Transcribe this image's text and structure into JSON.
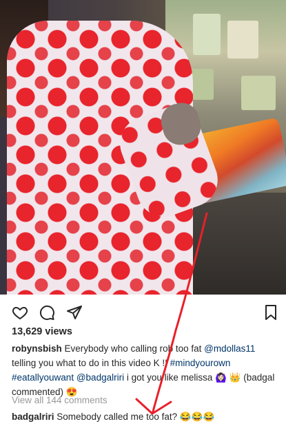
{
  "post": {
    "views": "13,629 views"
  },
  "caption": {
    "username": "robynsbish",
    "text_1": " Everybody who calling rob too fat ",
    "mention_1": "@mdollas11",
    "text_2": " telling you what to do in this video K !! ",
    "hashtag_1": "#mindyourown",
    "hashtag_2": "#eatallyouwant",
    "text_3": " ",
    "mention_2": "@badgalriri",
    "text_4": " i got you like melissa ",
    "emoji_1": "🙆🏻‍♀️",
    "emoji_2": "👑",
    "text_5": " (badgal commented) ",
    "emoji_3": "😍"
  },
  "comments": {
    "view_all_label": "View all 144 comments"
  },
  "top_comment": {
    "username": "badgalriri",
    "text": " Somebody called me too fat? 😂😂😂"
  },
  "icons": {
    "like": "heart-icon",
    "comment": "comment-bubble-icon",
    "share": "paper-plane-icon",
    "save": "bookmark-icon"
  },
  "colors": {
    "link": "#003569",
    "muted": "#999999",
    "annotation": "#e8202a"
  }
}
